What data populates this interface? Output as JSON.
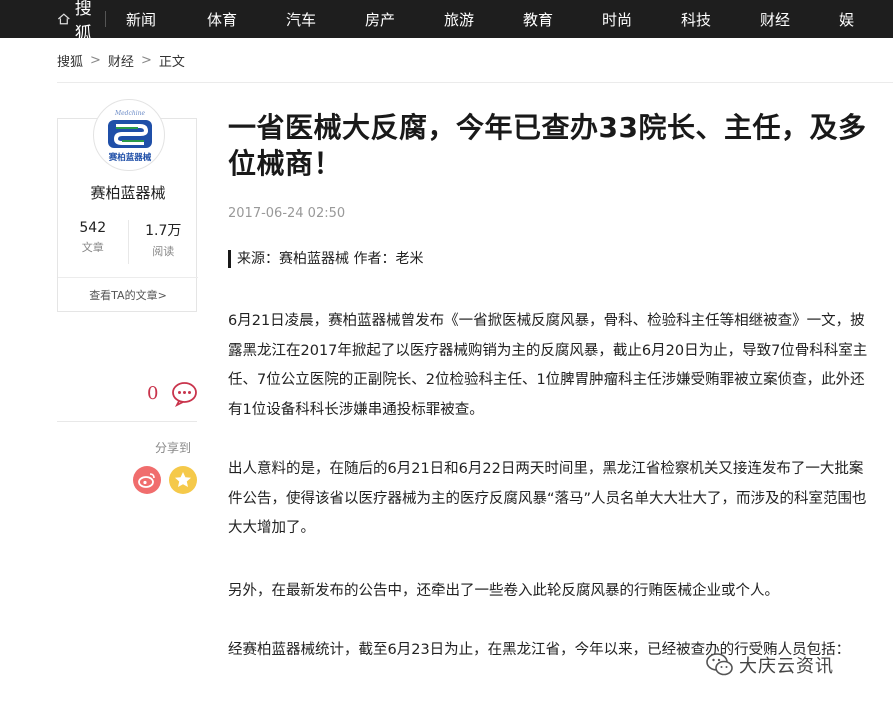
{
  "nav": {
    "brand": "搜狐",
    "items": [
      "新闻",
      "体育",
      "汽车",
      "房产",
      "旅游",
      "教育",
      "时尚",
      "科技",
      "财经",
      "娱"
    ]
  },
  "breadcrumb": [
    "搜狐",
    "财经",
    "正文"
  ],
  "author": {
    "logo_caption_top": "Medchine",
    "logo_caption": "赛柏蓝器械",
    "name": "赛柏蓝器械",
    "articles_count": "542",
    "articles_label": "文章",
    "reads_count": "1.7万",
    "reads_label": "阅读",
    "view_articles_link": "查看TA的文章>"
  },
  "tools": {
    "comment_count": "0",
    "share_label": "分享到"
  },
  "article": {
    "title": "一省医械大反腐，今年已查办33院长、主任，及多位械商！",
    "date": "2017-06-24 02:50",
    "source": "来源：赛柏蓝器械 作者：老米",
    "paragraphs": [
      "6月21日凌晨，赛柏蓝器械曾发布《一省掀医械反腐风暴，骨科、检验科主任等相继被查》一文，披露黑龙江在2017年掀起了以医疗器械购销为主的反腐风暴，截止6月20日为止，导致7位骨科科室主任、7位公立医院的正副院长、2位检验科主任、1位脾胃肿瘤科主任涉嫌受贿罪被立案侦查，此外还有1位设备科科长涉嫌串通投标罪被查。",
      "出人意料的是，在随后的6月21日和6月22日两天时间里，黑龙江省检察机关又接连发布了一大批案件公告，使得该省以医疗器械为主的医疗反腐风暴“落马”人员名单大大壮大了，而涉及的科室范围也大大增加了。",
      "另外，在最新发布的公告中，还牵出了一些卷入此轮反腐风暴的行贿医械企业或个人。",
      "经赛柏蓝器械统计，截至6月23日为止，在黑龙江省，今年以来，已经被查办的行受贿人员包括："
    ]
  },
  "watermark": "大庆云资讯",
  "colors": {
    "nav_bg": "#1e1e1e",
    "comment_red": "#c9344c",
    "weibo": "#f06d6d",
    "star": "#f5c94a",
    "logo_blue": "#1f4fa8",
    "logo_green": "#2a9a4a"
  }
}
